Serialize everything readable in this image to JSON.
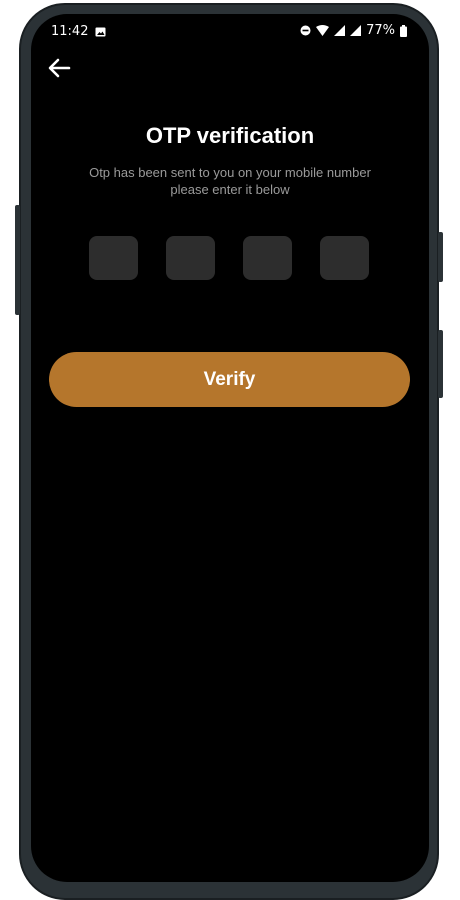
{
  "status_bar": {
    "time": "11:42",
    "battery": "77%",
    "icons": [
      "image-icon",
      "dnd-icon",
      "wifi-icon",
      "signal-icon",
      "signal-icon",
      "battery-icon"
    ]
  },
  "header": {
    "back_icon": "back-arrow-icon"
  },
  "main": {
    "title": "OTP verification",
    "subtitle_line1": "Otp has been sent to you on your mobile number",
    "subtitle_line2": "please enter it below",
    "otp_fields": [
      {
        "value": ""
      },
      {
        "value": ""
      },
      {
        "value": ""
      },
      {
        "value": ""
      }
    ],
    "verify_label": "Verify"
  },
  "colors": {
    "background": "#000000",
    "accent": "#b5762c",
    "otp_box": "#2d2d2d",
    "subtitle": "#9a9a9a"
  }
}
